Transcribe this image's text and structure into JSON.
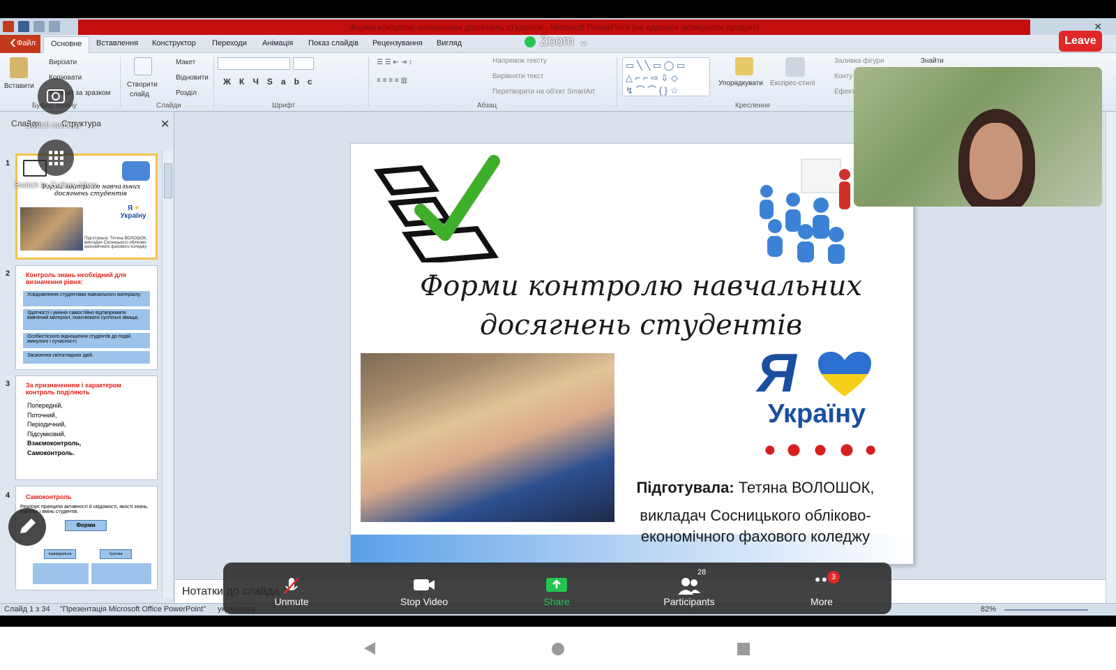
{
  "ppt": {
    "window_title": "Форми контролю навчальних досягнень студентів - Microsoft PowerPoint (не вдалося активувати продукт)",
    "tabs": [
      "Файл",
      "Основне",
      "Вставлення",
      "Конструктор",
      "Переходи",
      "Анімація",
      "Показ слайдів",
      "Рецензування",
      "Вигляд"
    ],
    "ribbon": {
      "paste": "Вставити",
      "cut": "Вирізати",
      "copy": "Копіювати",
      "format_painter": "Формат за зразком",
      "clipboard_group": "Буфер обміну",
      "new_slide_line1": "Створити",
      "new_slide_line2": "слайд",
      "layout": "Макет",
      "reset": "Відновити",
      "section": "Розділ",
      "slides_group": "Слайди",
      "font_group": "Шрифт",
      "text_direction": "Напрямок тексту",
      "align_text": "Вирівняти текст",
      "smartart": "Перетворити на об'єкт SmartArt",
      "paragraph_group": "Абзац",
      "arrange": "Упорядкувати",
      "quick_styles": "Експрес-стилі",
      "shape_fill": "Заливка фігури",
      "shape_outline": "Конту",
      "shape_effects": "Ефект",
      "drawing_group": "Креслення",
      "find": "Знайти"
    },
    "left_panel": {
      "tab_slides": "Слайди",
      "tab_outline": "Структура",
      "close": "✕",
      "thumbs": [
        {
          "num": "1",
          "title": "Форми контролю навчальних досягнень студентів",
          "subtitle": "Підготувала: Тетяна ВОЛОШОК, викладач Сосницького обліково-економічного фахового коледжу"
        },
        {
          "num": "2",
          "title": "Контроль знань необхідний для визначення рівня:",
          "items": [
            "Усвідомлення студентами навчального матеріалу;",
            "Здатності і уміння самостійно відтворювати вивчений матеріал, пояснювати суспільні явища;",
            "Особистісного відношення студентів до подій минулого і сучасності;",
            "Засвоєння світоглядних ідей."
          ]
        },
        {
          "num": "3",
          "title": "За призначенням і характером контроль поділяють",
          "items": [
            "Попередній,",
            "Поточний,",
            "Періодичний,",
            "Підсумковий,",
            "Взаємоконтроль,",
            "Самоконтроль."
          ]
        },
        {
          "num": "4",
          "title": "Самоконтроль",
          "text": "Реалізує принципи активності й свідомості, якості знань, навичок і вмінь студентів.",
          "box": "Форми",
          "box_left": "Індивідуальна",
          "box_right": "Групова"
        }
      ]
    },
    "slide": {
      "title_line1": "Форми контролю навчальних",
      "title_line2": "досягнень студентів",
      "ukraine_ya": "Я",
      "ukraine_word": "Україну",
      "prepared_label": "Підготувала:",
      "prepared_name": " Тетяна ВОЛОШОК,",
      "position_line1": "викладач Сосницького обліково-",
      "position_line2": "економічного фахового коледжу"
    },
    "notes_placeholder": "Нотатки до слайда",
    "status": {
      "slide_counter": "Слайд 1 з 34",
      "theme": "\"Презентація Microsoft Office PowerPoint\"",
      "language": "українська",
      "zoom": "82%"
    }
  },
  "zoom": {
    "title": "Zoom",
    "leave": "Leave",
    "switch_camera": "Switch camera",
    "gallery_view": "Switch to Gallery View",
    "toolbar": [
      {
        "id": "unmute",
        "label": "Unmute"
      },
      {
        "id": "stop-video",
        "label": "Stop Video"
      },
      {
        "id": "share",
        "label": "Share"
      },
      {
        "id": "participants",
        "label": "Participants",
        "count": "28"
      },
      {
        "id": "more",
        "label": "More",
        "badge": "3"
      }
    ],
    "colors": {
      "leave": "#e02828",
      "share": "#23c552",
      "badge": "#e02828"
    }
  }
}
